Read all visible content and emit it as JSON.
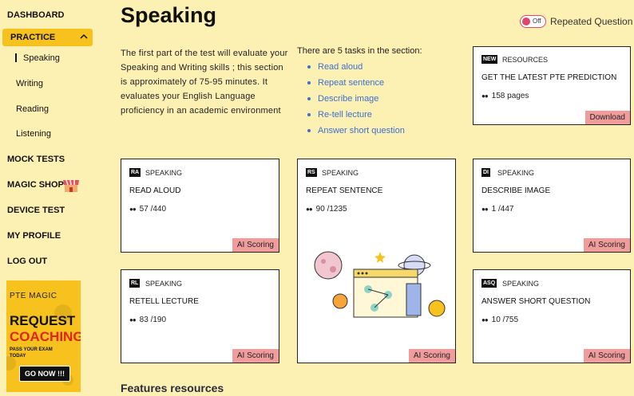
{
  "sidebar": {
    "dashboard": "DASHBOARD",
    "practice": "PRACTICE",
    "sub": [
      "Speaking",
      "Writing",
      "Reading",
      "Listening"
    ],
    "mock_tests": "MOCK TESTS",
    "magic_shop": "MAGIC SHOP",
    "device_test": "DEVICE TEST",
    "my_profile": "MY PROFILE",
    "log_out": "LOG OUT"
  },
  "ad": {
    "logo": "PTE MAGIC",
    "title1": "REQUEST",
    "title2": "COACHING",
    "tagline": "PASS YOUR EXAM TODAY",
    "cta": "GO NOW !!!"
  },
  "header": {
    "title": "Speaking",
    "toggle_state": "Off",
    "toggle_label": "Repeated Question"
  },
  "intro": {
    "text": "The first part of the test will evaluate your Speaking and Writing skills ; this section is approximately of 75-95 minutes. It evaluates your English Language proficiency in an academic environment",
    "tasks_heading": "There are 5 tasks in the section:",
    "tasks": [
      "Read aloud",
      "Repeat sentence",
      "Describe image",
      "Re-tell lecture",
      "Answer short question"
    ]
  },
  "resource": {
    "badge": "NEW",
    "category": "RESOURCES",
    "title": "GET THE LATEST PTE PREDICTION",
    "stat": "158 pages",
    "button": "Download"
  },
  "cards": {
    "ra": {
      "badge": "RA",
      "category": "SPEAKING",
      "name": "READ ALOUD",
      "stat": "57 /440",
      "button": "AI Scoring"
    },
    "rs": {
      "badge": "RS",
      "category": "SPEAKING",
      "name": "REPEAT SENTENCE",
      "stat": "90 /1235",
      "button": "AI Scoring"
    },
    "di": {
      "badge": "DI",
      "category": "SPEAKING",
      "name": "DESCRIBE IMAGE",
      "stat": "1 /447",
      "button": "AI Scoring"
    },
    "rl": {
      "badge": "RL",
      "category": "SPEAKING",
      "name": "RETELL LECTURE",
      "stat": "83 /190",
      "button": "AI Scoring"
    },
    "asq": {
      "badge": "ASQ",
      "category": "SPEAKING",
      "name": "ANSWER SHORT QUESTION",
      "stat": "10 /755",
      "button": "AI Scoring"
    }
  },
  "features_title": "Features resources",
  "colors": {
    "background": "#fdf0b3",
    "accent_yellow": "#f7c21d",
    "ai_button": "#f19c9c",
    "link_blue": "#3b6fd4",
    "toggle_red": "#e2456a"
  }
}
